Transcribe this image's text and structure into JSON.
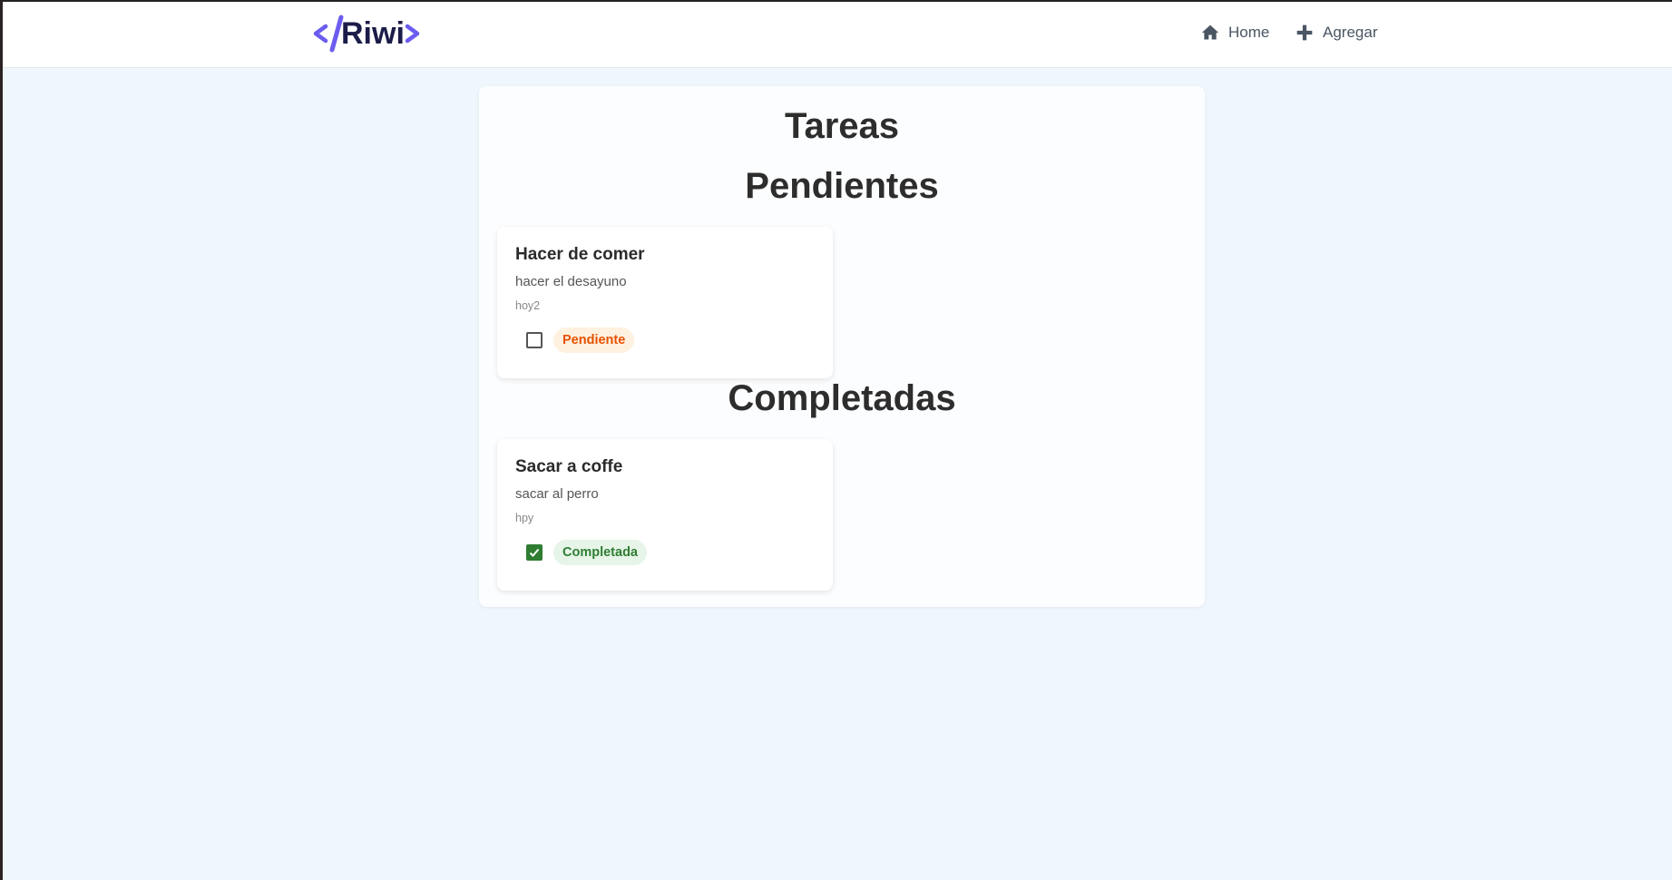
{
  "nav": {
    "logo_text": "</Riwi>",
    "links": [
      {
        "label": "Home",
        "icon": "home-icon"
      },
      {
        "label": "Agregar",
        "icon": "plus-icon"
      }
    ]
  },
  "main": {
    "title": "Tareas",
    "pending_heading": "Pendientes",
    "completed_heading": "Completadas",
    "pending": [
      {
        "title": "Hacer de comer",
        "description": "hacer el desayuno",
        "date": "hoy2",
        "checked": false,
        "status": "Pendiente"
      }
    ],
    "completed": [
      {
        "title": "Sacar a coffe",
        "description": "sacar al perro",
        "date": "hpy",
        "checked": true,
        "status": "Completada"
      }
    ]
  },
  "colors": {
    "accent": "#6c5cf0",
    "logo_dark": "#1c1c4a",
    "pending": "#e65100",
    "completed": "#2e7d32"
  }
}
